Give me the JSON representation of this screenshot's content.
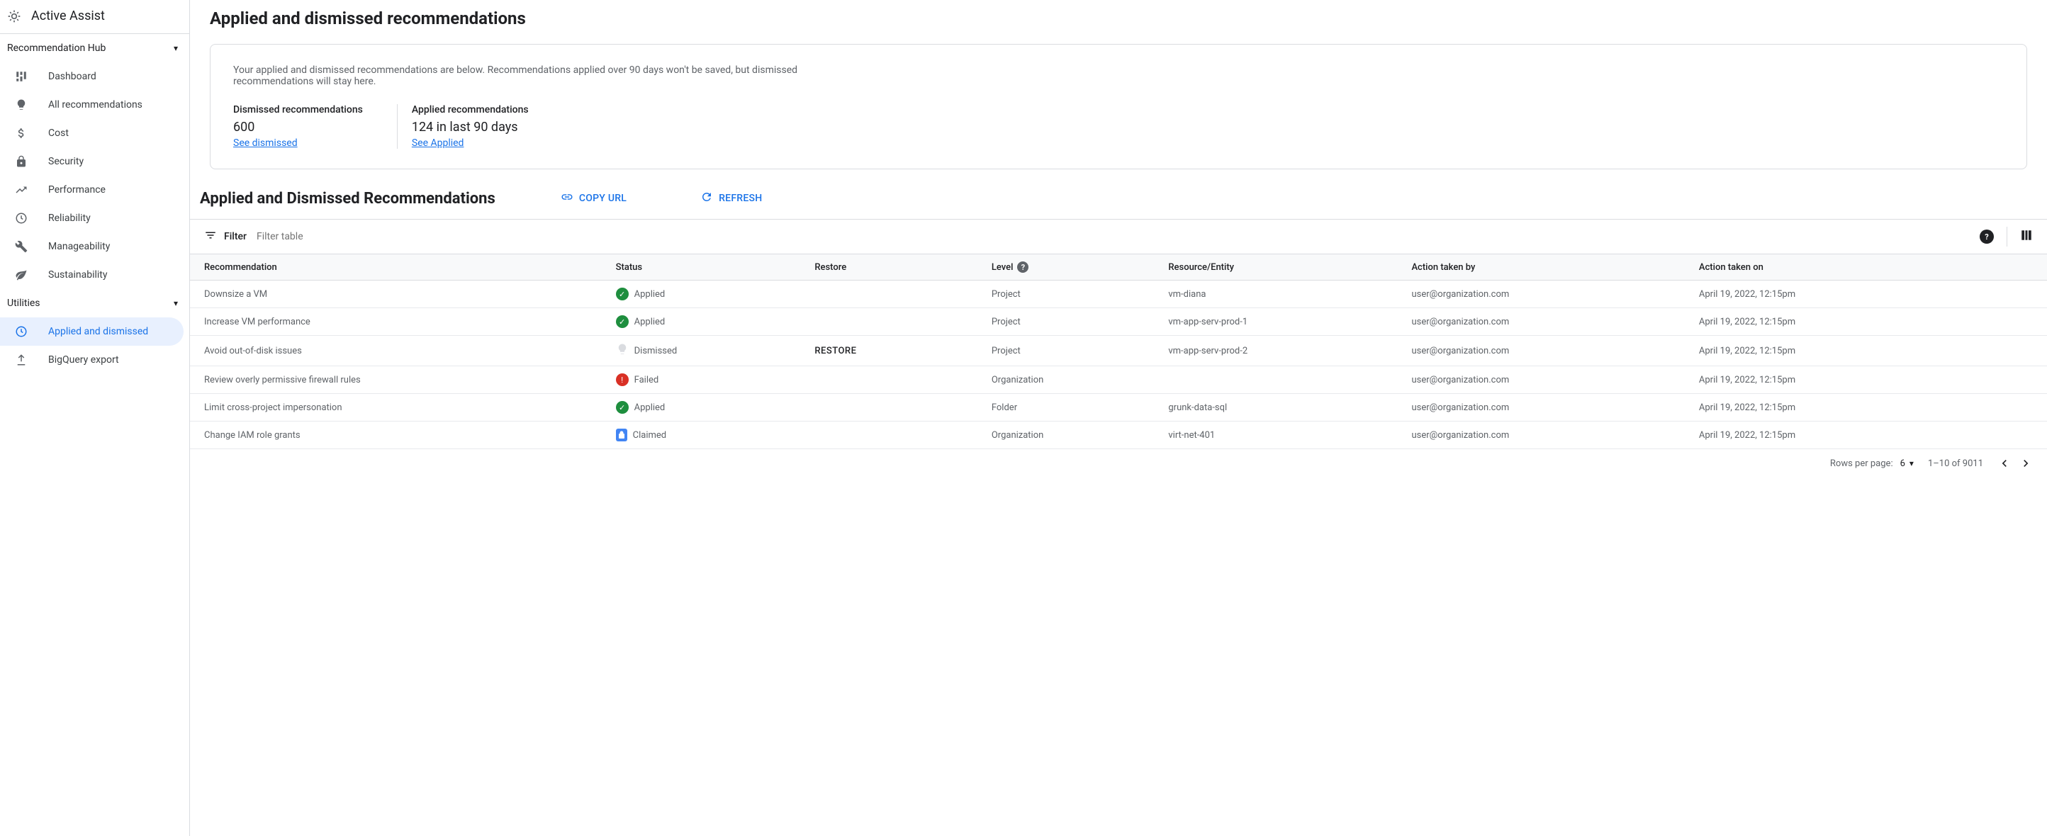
{
  "header": {
    "product": "Active Assist"
  },
  "sidebar": {
    "sections": [
      {
        "title": "Recommendation Hub",
        "items": [
          {
            "icon": "dashboard",
            "label": "Dashboard"
          },
          {
            "icon": "lightbulb",
            "label": "All recommendations"
          },
          {
            "icon": "dollar",
            "label": "Cost"
          },
          {
            "icon": "lock",
            "label": "Security"
          },
          {
            "icon": "trend",
            "label": "Performance"
          },
          {
            "icon": "clock",
            "label": "Reliability"
          },
          {
            "icon": "wrench",
            "label": "Manageability"
          },
          {
            "icon": "leaf",
            "label": "Sustainability"
          }
        ]
      },
      {
        "title": "Utilities",
        "items": [
          {
            "icon": "history",
            "label": "Applied and dismissed",
            "active": true
          },
          {
            "icon": "upload",
            "label": "BigQuery export"
          }
        ]
      }
    ]
  },
  "page": {
    "title": "Applied and dismissed recommendations",
    "description": "Your applied and dismissed recommendations are below. Recommendations applied over 90 days won't be saved, but dismissed recommendations will stay here.",
    "stats": [
      {
        "label": "Dismissed recommendations",
        "value": "600",
        "link": "See dismissed"
      },
      {
        "label": "Applied recommendations",
        "value": "124 in last 90 days",
        "link": "See Applied"
      }
    ],
    "section_title": "Applied and Dismissed Recommendations",
    "actions": {
      "copy": "COPY URL",
      "refresh": "REFRESH"
    }
  },
  "filter": {
    "label": "Filter",
    "placeholder": "Filter table"
  },
  "columns": {
    "recommendation": "Recommendation",
    "status": "Status",
    "restore": "Restore",
    "level": "Level",
    "resource": "Resource/Entity",
    "action_by": "Action taken by",
    "action_on": "Action taken on"
  },
  "column_widths": {
    "recommendation": "19%",
    "status": "9%",
    "restore": "8%",
    "level": "8%",
    "resource": "11%",
    "action_by": "13%",
    "action_on": "16%"
  },
  "restore_label": "RESTORE",
  "rows": [
    {
      "rec": "Downsize a VM",
      "status": "Applied",
      "status_type": "applied",
      "restore": "",
      "level": "Project",
      "resource": "vm-diana",
      "by": "user@organization.com",
      "on": "April 19, 2022, 12:15pm"
    },
    {
      "rec": "Increase VM performance",
      "status": "Applied",
      "status_type": "applied",
      "restore": "",
      "level": "Project",
      "resource": "vm-app-serv-prod-1",
      "by": "user@organization.com",
      "on": "April 19, 2022, 12:15pm"
    },
    {
      "rec": "Avoid out-of-disk issues",
      "status": "Dismissed",
      "status_type": "dismissed",
      "restore": "RESTORE",
      "level": "Project",
      "resource": "vm-app-serv-prod-2",
      "by": "user@organization.com",
      "on": "April 19, 2022, 12:15pm"
    },
    {
      "rec": "Review overly permissive firewall rules",
      "status": "Failed",
      "status_type": "failed",
      "restore": "",
      "level": "Organization",
      "resource": "",
      "by": "user@organization.com",
      "on": "April 19, 2022, 12:15pm"
    },
    {
      "rec": "Limit cross-project impersonation",
      "status": "Applied",
      "status_type": "applied",
      "restore": "",
      "level": "Folder",
      "resource": "grunk-data-sql",
      "by": "user@organization.com",
      "on": "April 19, 2022, 12:15pm"
    },
    {
      "rec": "Change IAM role grants",
      "status": "Claimed",
      "status_type": "claimed",
      "restore": "",
      "level": "Organization",
      "resource": "virt-net-401",
      "by": "user@organization.com",
      "on": "April 19, 2022, 12:15pm"
    }
  ],
  "pagination": {
    "rows_label": "Rows per page:",
    "rows_value": "6",
    "range": "1–10 of 9011"
  }
}
